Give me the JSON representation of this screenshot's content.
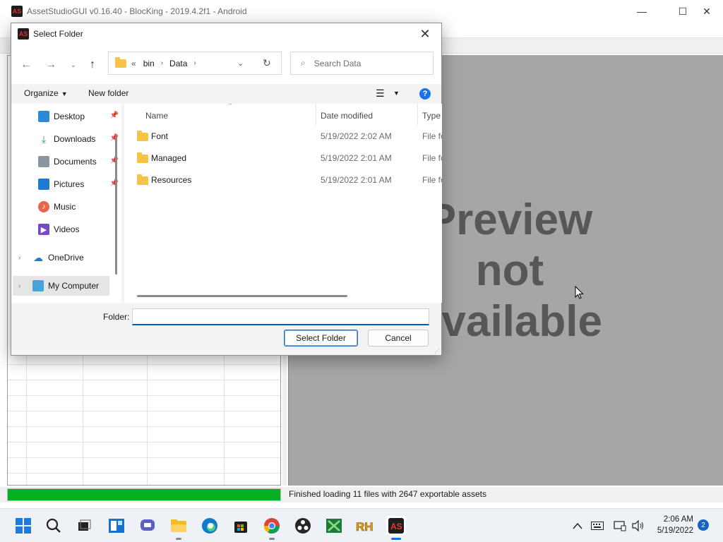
{
  "app": {
    "title": "AssetStudioGUI v0.16.40 - BlocKing - 2019.4.2f1 - Android",
    "icon_label": "AS"
  },
  "preview": {
    "line1": "Preview",
    "line2": "not",
    "line3": "available"
  },
  "status": {
    "text": "Finished loading 11 files with 2647 exportable assets",
    "progress_fraction": 1.0,
    "progress_color": "#06b025"
  },
  "dialog": {
    "title": "Select Folder",
    "address": {
      "overflow": "«",
      "crumbs": [
        "bin",
        "Data"
      ]
    },
    "search_placeholder": "Search Data",
    "commands": {
      "organize": "Organize",
      "new_folder": "New folder",
      "help": "?"
    },
    "nav": [
      {
        "label": "Desktop",
        "icon": "desktop-icon",
        "pinned": true
      },
      {
        "label": "Downloads",
        "icon": "downloads-icon",
        "pinned": true
      },
      {
        "label": "Documents",
        "icon": "documents-icon",
        "pinned": true
      },
      {
        "label": "Pictures",
        "icon": "pictures-icon",
        "pinned": true
      },
      {
        "label": "Music",
        "icon": "music-icon",
        "pinned": false
      },
      {
        "label": "Videos",
        "icon": "videos-icon",
        "pinned": false
      },
      {
        "label": "OneDrive",
        "icon": "onedrive-icon",
        "pinned": false
      },
      {
        "label": "My Computer",
        "icon": "computer-icon",
        "pinned": false
      }
    ],
    "columns": {
      "name": "Name",
      "date": "Date modified",
      "type": "Type"
    },
    "files": [
      {
        "name": "Font",
        "date": "5/19/2022 2:02 AM",
        "type": "File fo"
      },
      {
        "name": "Managed",
        "date": "5/19/2022 2:01 AM",
        "type": "File fo"
      },
      {
        "name": "Resources",
        "date": "5/19/2022 2:01 AM",
        "type": "File fo"
      }
    ],
    "folder_label": "Folder:",
    "folder_value": "",
    "select_button": "Select Folder",
    "cancel_button": "Cancel"
  },
  "taskbar": {
    "time": "2:06 AM",
    "date": "5/19/2022",
    "notifications": "2",
    "apps": [
      "start-icon",
      "search-icon",
      "task-view-icon",
      "widgets-icon",
      "teams-chat-icon",
      "file-explorer-icon",
      "edge-icon",
      "store-icon",
      "chrome-icon",
      "obs-icon",
      "spreadsheet-icon",
      "rh-icon",
      "assetstudio-icon"
    ]
  }
}
